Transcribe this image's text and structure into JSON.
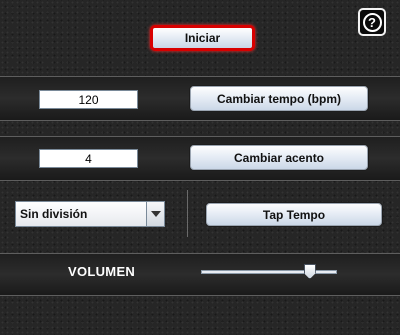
{
  "help": {
    "glyph": "?",
    "icon": "help-icon"
  },
  "start_button": {
    "label": "Iniciar",
    "highlight_color": "#d80000"
  },
  "tempo": {
    "value": "120",
    "button_label": "Cambiar tempo (bpm)"
  },
  "accent": {
    "value": "4",
    "button_label": "Cambiar acento"
  },
  "subdivision": {
    "selected": "Sin división",
    "icon": "chevron-down-icon"
  },
  "tap": {
    "button_label": "Tap Tempo"
  },
  "volume": {
    "label": "VOLUMEN",
    "level": 0.8
  }
}
